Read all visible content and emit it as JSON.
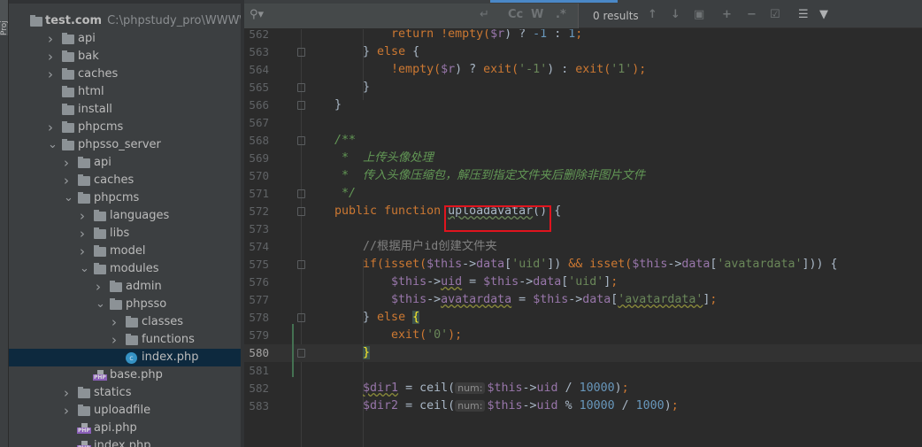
{
  "project": {
    "tab": "Proj",
    "root_label": "test.com",
    "root_path": "C:\\phpstudy_pro\\WWW\\test."
  },
  "tree": [
    {
      "level": 1,
      "arrow": ">",
      "type": "folder",
      "label": "api"
    },
    {
      "level": 1,
      "arrow": ">",
      "type": "folder",
      "label": "bak"
    },
    {
      "level": 1,
      "arrow": ">",
      "type": "folder",
      "label": "caches"
    },
    {
      "level": 1,
      "arrow": "",
      "type": "folder",
      "label": "html"
    },
    {
      "level": 1,
      "arrow": "",
      "type": "folder",
      "label": "install"
    },
    {
      "level": 1,
      "arrow": ">",
      "type": "folder",
      "label": "phpcms"
    },
    {
      "level": 1,
      "arrow": "v",
      "type": "folder",
      "label": "phpsso_server"
    },
    {
      "level": 2,
      "arrow": ">",
      "type": "folder",
      "label": "api"
    },
    {
      "level": 2,
      "arrow": ">",
      "type": "folder",
      "label": "caches"
    },
    {
      "level": 2,
      "arrow": "v",
      "type": "folder",
      "label": "phpcms"
    },
    {
      "level": 3,
      "arrow": ">",
      "type": "folder",
      "label": "languages"
    },
    {
      "level": 3,
      "arrow": ">",
      "type": "folder",
      "label": "libs"
    },
    {
      "level": 3,
      "arrow": ">",
      "type": "folder",
      "label": "model"
    },
    {
      "level": 3,
      "arrow": "v",
      "type": "folder",
      "label": "modules"
    },
    {
      "level": 4,
      "arrow": ">",
      "type": "folder",
      "label": "admin"
    },
    {
      "level": 4,
      "arrow": "v",
      "type": "folder",
      "label": "phpsso"
    },
    {
      "level": 5,
      "arrow": ">",
      "type": "folder",
      "label": "classes"
    },
    {
      "level": 5,
      "arrow": ">",
      "type": "folder",
      "label": "functions"
    },
    {
      "level": 5,
      "arrow": "",
      "type": "cls",
      "label": "index.php",
      "selected": true
    },
    {
      "level": 3,
      "arrow": "",
      "type": "php",
      "label": "base.php"
    },
    {
      "level": 2,
      "arrow": ">",
      "type": "folder",
      "label": "statics"
    },
    {
      "level": 2,
      "arrow": ">",
      "type": "folder",
      "label": "uploadfile"
    },
    {
      "level": 2,
      "arrow": "",
      "type": "php",
      "label": "api.php"
    },
    {
      "level": 2,
      "arrow": "",
      "type": "php",
      "label": "index.php"
    }
  ],
  "search": {
    "value": "",
    "results": "0 results",
    "match_case": "Cc",
    "words": "W",
    "regex": ".*"
  },
  "editor": {
    "current_line": 580,
    "highlighted_function": "uploadavatar",
    "lines": [
      {
        "n": 562,
        "t": [
          [
            "        ",
            ""
          ],
          [
            "return !empty(",
            "k"
          ],
          [
            "$r",
            "v"
          ],
          [
            ") ? ",
            ""
          ],
          [
            "-1",
            "n"
          ],
          [
            " : ",
            ""
          ],
          [
            "1",
            "n"
          ],
          [
            ";",
            "k"
          ]
        ]
      },
      {
        "n": 563,
        "t": [
          [
            "    } ",
            ""
          ],
          [
            "else",
            "k"
          ],
          [
            " {",
            ""
          ]
        ]
      },
      {
        "n": 564,
        "t": [
          [
            "        ",
            ""
          ],
          [
            "!empty(",
            "k"
          ],
          [
            "$r",
            "v"
          ],
          [
            ") ? ",
            ""
          ],
          [
            "exit(",
            "k"
          ],
          [
            "'-1'",
            "s"
          ],
          [
            ") : ",
            ""
          ],
          [
            "exit(",
            "k"
          ],
          [
            "'1'",
            "s"
          ],
          [
            ");",
            "k"
          ]
        ]
      },
      {
        "n": 565,
        "t": [
          [
            "    }",
            ""
          ]
        ]
      },
      {
        "n": 566,
        "t": [
          [
            "}",
            ""
          ]
        ]
      },
      {
        "n": 567,
        "t": []
      },
      {
        "n": 568,
        "t": [
          [
            "/**",
            "d"
          ]
        ]
      },
      {
        "n": 569,
        "t": [
          [
            " *  上传头像处理",
            "d"
          ]
        ]
      },
      {
        "n": 570,
        "t": [
          [
            " *  传入头像压缩包，解压到指定文件夹后删除非图片文件",
            "d"
          ]
        ]
      },
      {
        "n": 571,
        "t": [
          [
            " */",
            "d"
          ]
        ]
      },
      {
        "n": 572,
        "t": [
          [
            "public function ",
            "k"
          ],
          [
            "uploadavatar",
            "f"
          ],
          [
            "() {",
            ""
          ]
        ]
      },
      {
        "n": 573,
        "t": []
      },
      {
        "n": 574,
        "t": [
          [
            "    ",
            ""
          ],
          [
            "//根据用户id创建文件夹",
            "c"
          ]
        ]
      },
      {
        "n": 575,
        "t": [
          [
            "    ",
            ""
          ],
          [
            "if(isset(",
            "k"
          ],
          [
            "$this",
            "v"
          ],
          [
            "->",
            ""
          ],
          [
            "data",
            "v"
          ],
          [
            "[",
            ""
          ],
          [
            "'uid'",
            "s"
          ],
          [
            "]) ",
            ""
          ],
          [
            "&& isset(",
            "k"
          ],
          [
            "$this",
            "v"
          ],
          [
            "->",
            ""
          ],
          [
            "data",
            "v"
          ],
          [
            "[",
            ""
          ],
          [
            "'avatardata'",
            "s"
          ],
          [
            "])) {",
            ""
          ]
        ]
      },
      {
        "n": 576,
        "t": [
          [
            "        ",
            ""
          ],
          [
            "$this",
            "v"
          ],
          [
            "->",
            ""
          ],
          [
            "uid",
            "v w"
          ],
          [
            " = ",
            ""
          ],
          [
            "$this",
            "v"
          ],
          [
            "->",
            ""
          ],
          [
            "data",
            "v"
          ],
          [
            "[",
            ""
          ],
          [
            "'uid'",
            "s"
          ],
          [
            "]",
            ""
          ],
          [
            ";",
            "k"
          ]
        ]
      },
      {
        "n": 577,
        "t": [
          [
            "        ",
            ""
          ],
          [
            "$this",
            "v"
          ],
          [
            "->",
            ""
          ],
          [
            "avatardata",
            "v w"
          ],
          [
            " = ",
            ""
          ],
          [
            "$this",
            "v"
          ],
          [
            "->",
            ""
          ],
          [
            "data",
            "v"
          ],
          [
            "[",
            ""
          ],
          [
            "'avatardata'",
            "s w"
          ],
          [
            "]",
            ""
          ],
          [
            ";",
            "k"
          ]
        ]
      },
      {
        "n": 578,
        "t": [
          [
            "    } ",
            ""
          ],
          [
            "else ",
            "k"
          ],
          [
            "{",
            "bm"
          ]
        ]
      },
      {
        "n": 579,
        "t": [
          [
            "        ",
            ""
          ],
          [
            "exit(",
            "k"
          ],
          [
            "'0'",
            "s"
          ],
          [
            ");",
            "k"
          ]
        ]
      },
      {
        "n": 580,
        "t": [
          [
            "    ",
            ""
          ],
          [
            "}",
            "bm"
          ]
        ]
      },
      {
        "n": 581,
        "t": []
      },
      {
        "n": 582,
        "t": [
          [
            "    ",
            ""
          ],
          [
            "$dir1",
            "v w"
          ],
          [
            " = ceil(",
            ""
          ],
          [
            "num:",
            "h"
          ],
          [
            "$this",
            "v"
          ],
          [
            "->",
            ""
          ],
          [
            "uid",
            "v"
          ],
          [
            " / ",
            ""
          ],
          [
            "10000",
            "n"
          ],
          [
            ")",
            ""
          ],
          [
            ";",
            "k"
          ]
        ]
      },
      {
        "n": 583,
        "t": [
          [
            "    ",
            ""
          ],
          [
            "$dir2",
            "v"
          ],
          [
            " = ceil(",
            ""
          ],
          [
            "num:",
            "h"
          ],
          [
            "$this",
            "v"
          ],
          [
            "->",
            ""
          ],
          [
            "uid",
            "v"
          ],
          [
            " % ",
            ""
          ],
          [
            "10000",
            "n"
          ],
          [
            " / ",
            ""
          ],
          [
            "1000",
            "n"
          ],
          [
            ")",
            ""
          ],
          [
            ";",
            "k"
          ]
        ]
      }
    ]
  },
  "colors": {
    "keyword": "#cc7832",
    "variable": "#9876aa",
    "string": "#6a8759",
    "number": "#6897bb",
    "doc_comment": "#629755",
    "annotation_box": "#e0141e"
  }
}
